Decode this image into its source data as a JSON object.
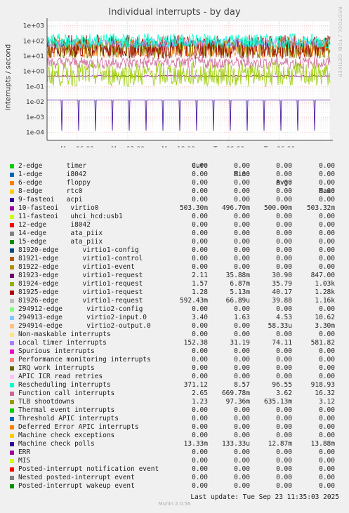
{
  "chart_data": {
    "type": "line",
    "title": "Individual interrupts - by day",
    "ylabel": "interrupts / second",
    "side_label": "RRDTOOL / TOBI OETIKER",
    "yscale": "log",
    "ylim": [
      3e-05,
      2000
    ],
    "yticks": [
      "1e+03",
      "1e+02",
      "1e+01",
      "1e+00",
      "1e-01",
      "1e-02",
      "1e-03",
      "1e-04"
    ],
    "xticks": [
      "Mon 06:00",
      "Mon 12:00",
      "Mon 18:00",
      "Tue 00:00",
      "Tue 06:00"
    ],
    "grid": true,
    "series": [
      {
        "name": "10-fasteoi virtio0",
        "color": "#880088",
        "base": 0.5,
        "jitter": 0.05
      },
      {
        "name": "23923-edge virtio1-request",
        "color": "#ff8000",
        "base": 30.9,
        "jitter": 0.6
      },
      {
        "name": "81924-edge virtio1-request",
        "color": "#7f7f00",
        "base": 35.79,
        "jitter": 0.7
      },
      {
        "name": "81925-edge virtio1-request",
        "color": "#990000",
        "base": 40.17,
        "jitter": 0.8
      },
      {
        "name": "Local timer interrupts",
        "color": "#9999ff",
        "base": 74.11,
        "jitter": 0.3
      },
      {
        "name": "Rescheduling interrupts",
        "color": "#00ffcc",
        "base": 96.55,
        "jitter": 0.5
      },
      {
        "name": "Function call interrupts",
        "color": "#cc6699",
        "base": 3.62,
        "jitter": 0.4
      },
      {
        "name": "TLB shootdowns",
        "color": "#99cc00",
        "base": 0.635,
        "jitter": 0.8
      },
      {
        "name": "Machine check polls",
        "color": "#330099",
        "base": 0.0133,
        "jitter": 0.0
      }
    ]
  },
  "legend": {
    "columns": [
      "Cur:",
      "Min:",
      "Avg:",
      "Max:"
    ],
    "rows": [
      {
        "label": "2-edge      timer",
        "color": "#00cc00",
        "cur": "0.00",
        "min": "0.00",
        "avg": "0.00",
        "max": "0.00"
      },
      {
        "label": "1-edge      i8042",
        "color": "#0066b3",
        "cur": "0.00",
        "min": "0.00",
        "avg": "0.00",
        "max": "0.00"
      },
      {
        "label": "6-edge      floppy",
        "color": "#ff8000",
        "cur": "0.00",
        "min": "0.00",
        "avg": "0.00",
        "max": "0.00"
      },
      {
        "label": "8-edge      rtc0",
        "color": "#ffcc00",
        "cur": "0.00",
        "min": "0.00",
        "avg": "0.00",
        "max": "0.00"
      },
      {
        "label": "9-fasteoi   acpi",
        "color": "#330099",
        "cur": "0.00",
        "min": "0.00",
        "avg": "0.00",
        "max": "0.00"
      },
      {
        "label": "10-fasteoi   virtio0",
        "color": "#990099",
        "cur": "503.30m",
        "min": "496.70m",
        "avg": "500.00m",
        "max": "503.32m"
      },
      {
        "label": "11-fasteoi   uhci_hcd:usb1",
        "color": "#ccff00",
        "cur": "0.00",
        "min": "0.00",
        "avg": "0.00",
        "max": "0.00"
      },
      {
        "label": "12-edge      i8042",
        "color": "#ff0000",
        "cur": "0.00",
        "min": "0.00",
        "avg": "0.00",
        "max": "0.00"
      },
      {
        "label": "14-edge      ata_piix",
        "color": "#808080",
        "cur": "0.00",
        "min": "0.00",
        "avg": "0.00",
        "max": "0.00"
      },
      {
        "label": "15-edge      ata_piix",
        "color": "#008f00",
        "cur": "0.00",
        "min": "0.00",
        "avg": "0.00",
        "max": "0.00"
      },
      {
        "label": "81920-edge      virtio1-config",
        "color": "#00487d",
        "cur": "0.00",
        "min": "0.00",
        "avg": "0.00",
        "max": "0.00"
      },
      {
        "label": "81921-edge      virtio1-control",
        "color": "#b35a00",
        "cur": "0.00",
        "min": "0.00",
        "avg": "0.00",
        "max": "0.00"
      },
      {
        "label": "81922-edge      virtio1-event",
        "color": "#b38f00",
        "cur": "0.00",
        "min": "0.00",
        "avg": "0.00",
        "max": "0.00"
      },
      {
        "label": "81923-edge      virtio1-request",
        "color": "#6b006b",
        "cur": "2.11",
        "min": "35.88m",
        "avg": "30.90",
        "max": "847.00"
      },
      {
        "label": "81924-edge      virtio1-request",
        "color": "#8fb300",
        "cur": "1.57",
        "min": "6.87m",
        "avg": "35.79",
        "max": "1.03k"
      },
      {
        "label": "81925-edge      virtio1-request",
        "color": "#b30000",
        "cur": "1.28",
        "min": "5.13m",
        "avg": "40.17",
        "max": "1.28k"
      },
      {
        "label": "81926-edge      virtio1-request",
        "color": "#bebebe",
        "cur": "592.43m",
        "min": "66.89u",
        "avg": "39.88",
        "max": "1.16k"
      },
      {
        "label": "294912-edge      virtio2-config",
        "color": "#80ff80",
        "cur": "0.00",
        "min": "0.00",
        "avg": "0.00",
        "max": "0.00"
      },
      {
        "label": "294913-edge      virtio2-input.0",
        "color": "#80c9ff",
        "cur": "3.40",
        "min": "1.63",
        "avg": "4.53",
        "max": "10.62"
      },
      {
        "label": "294914-edge      virtio2-output.0",
        "color": "#ffc080",
        "cur": "0.00",
        "min": "0.00",
        "avg": "58.33u",
        "max": "3.30m"
      },
      {
        "label": "Non-maskable interrupts",
        "color": "#ffe680",
        "cur": "0.00",
        "min": "0.00",
        "avg": "0.00",
        "max": "0.00"
      },
      {
        "label": "Local timer interrupts",
        "color": "#aa80ff",
        "cur": "152.38",
        "min": "31.19",
        "avg": "74.11",
        "max": "581.82"
      },
      {
        "label": "Spurious interrupts",
        "color": "#ee00cc",
        "cur": "0.00",
        "min": "0.00",
        "avg": "0.00",
        "max": "0.00"
      },
      {
        "label": "Performance monitoring interrupts",
        "color": "#ff8080",
        "cur": "0.00",
        "min": "0.00",
        "avg": "0.00",
        "max": "0.00"
      },
      {
        "label": "IRQ work interrupts",
        "color": "#666600",
        "cur": "0.00",
        "min": "0.00",
        "avg": "0.00",
        "max": "0.00"
      },
      {
        "label": "APIC ICR read retries",
        "color": "#ffbfff",
        "cur": "0.00",
        "min": "0.00",
        "avg": "0.00",
        "max": "0.00"
      },
      {
        "label": "Rescheduling interrupts",
        "color": "#00ffcc",
        "cur": "371.12",
        "min": "8.57",
        "avg": "96.55",
        "max": "918.93"
      },
      {
        "label": "Function call interrupts",
        "color": "#cc6699",
        "cur": "2.65",
        "min": "669.78m",
        "avg": "3.62",
        "max": "16.32"
      },
      {
        "label": "TLB shootdowns",
        "color": "#999900",
        "cur": "1.23",
        "min": "97.36m",
        "avg": "635.13m",
        "max": "3.12"
      },
      {
        "label": "Thermal event interrupts",
        "color": "#00cc00",
        "cur": "0.00",
        "min": "0.00",
        "avg": "0.00",
        "max": "0.00"
      },
      {
        "label": "Threshold APIC interrupts",
        "color": "#0066b3",
        "cur": "0.00",
        "min": "0.00",
        "avg": "0.00",
        "max": "0.00"
      },
      {
        "label": "Deferred Error APIC interrupts",
        "color": "#ff8000",
        "cur": "0.00",
        "min": "0.00",
        "avg": "0.00",
        "max": "0.00"
      },
      {
        "label": "Machine check exceptions",
        "color": "#ffcc00",
        "cur": "0.00",
        "min": "0.00",
        "avg": "0.00",
        "max": "0.00"
      },
      {
        "label": "Machine check polls",
        "color": "#330099",
        "cur": "13.33m",
        "min": "133.33u",
        "avg": "12.87m",
        "max": "13.88m"
      },
      {
        "label": "ERR",
        "color": "#990099",
        "cur": "0.00",
        "min": "0.00",
        "avg": "0.00",
        "max": "0.00"
      },
      {
        "label": "MIS",
        "color": "#ccff00",
        "cur": "0.00",
        "min": "0.00",
        "avg": "0.00",
        "max": "0.00"
      },
      {
        "label": "Posted-interrupt notification event",
        "color": "#ff0000",
        "cur": "0.00",
        "min": "0.00",
        "avg": "0.00",
        "max": "0.00"
      },
      {
        "label": "Nested posted-interrupt event",
        "color": "#808080",
        "cur": "0.00",
        "min": "0.00",
        "avg": "0.00",
        "max": "0.00"
      },
      {
        "label": "Posted-interrupt wakeup event",
        "color": "#008f00",
        "cur": "0.00",
        "min": "0.00",
        "avg": "0.00",
        "max": "0.00"
      }
    ]
  },
  "last_update": "Last update: Tue Sep 23 11:35:03 2025",
  "footer": "Munin 2.0.56"
}
